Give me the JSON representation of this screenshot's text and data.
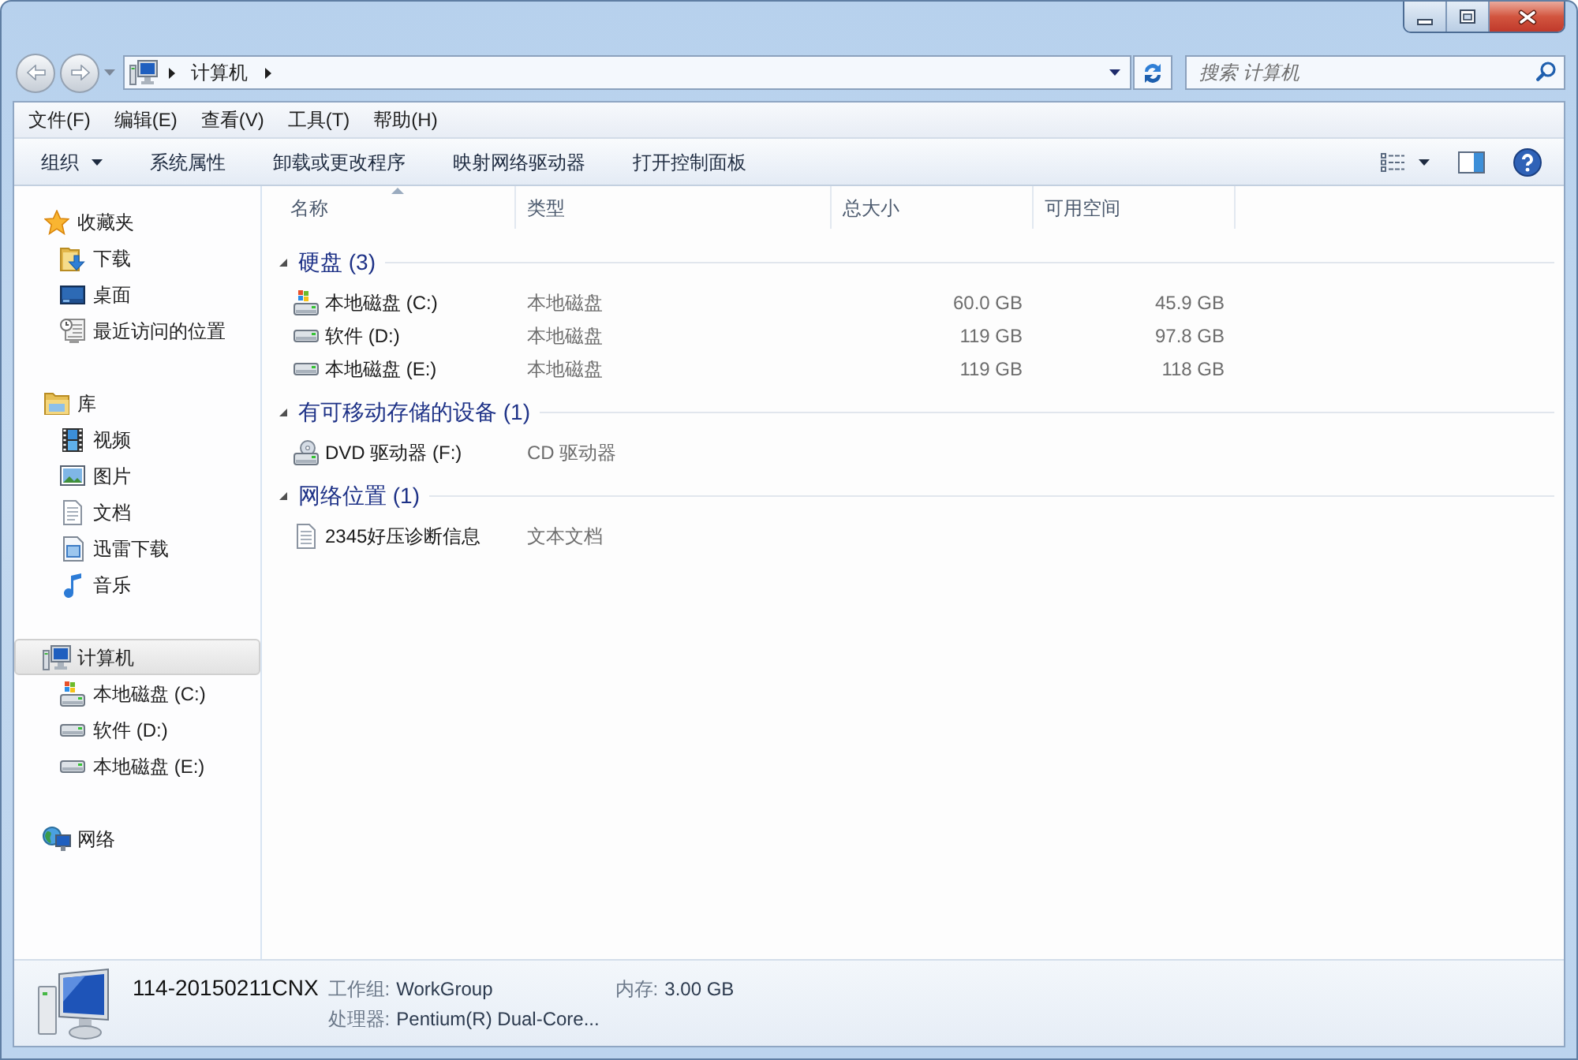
{
  "navigation": {
    "back": {
      "disabled": true
    },
    "forward": {
      "disabled": true
    }
  },
  "address_bar": {
    "path": [
      {
        "label": "计算机"
      }
    ]
  },
  "search": {
    "placeholder": "搜索 计算机"
  },
  "menu_bar": [
    "文件(F)",
    "编辑(E)",
    "查看(V)",
    "工具(T)",
    "帮助(H)"
  ],
  "command_bar": {
    "items": [
      {
        "label": "组织",
        "kind": "dropdown"
      },
      {
        "label": "系统属性",
        "kind": "button"
      },
      {
        "label": "卸载或更改程序",
        "kind": "button"
      },
      {
        "label": "映射网络驱动器",
        "kind": "button"
      },
      {
        "label": "打开控制面板",
        "kind": "button"
      }
    ]
  },
  "sidebar": {
    "sections": [
      {
        "label": "收藏夹",
        "kind": "favorites",
        "selected": false,
        "children": [
          {
            "label": "下载",
            "kind": "downloads",
            "selected": false
          },
          {
            "label": "桌面",
            "kind": "desktop",
            "selected": false
          },
          {
            "label": "最近访问的位置",
            "kind": "recent",
            "selected": false
          }
        ]
      },
      {
        "label": "库",
        "kind": "libraries",
        "selected": false,
        "children": [
          {
            "label": "视频",
            "kind": "videos",
            "selected": false
          },
          {
            "label": "图片",
            "kind": "pictures",
            "selected": false
          },
          {
            "label": "文档",
            "kind": "documents",
            "selected": false
          },
          {
            "label": "迅雷下载",
            "kind": "folder",
            "selected": false
          },
          {
            "label": "音乐",
            "kind": "music",
            "selected": false
          }
        ]
      },
      {
        "label": "计算机",
        "kind": "computer",
        "selected": true,
        "children": [
          {
            "label": "本地磁盘 (C:)",
            "kind": "system",
            "selected": false
          },
          {
            "label": "软件 (D:)",
            "kind": "drive",
            "selected": false
          },
          {
            "label": "本地磁盘 (E:)",
            "kind": "drive",
            "selected": false
          }
        ]
      },
      {
        "label": "网络",
        "kind": "network",
        "selected": false
      }
    ]
  },
  "content": {
    "columns": [
      {
        "label": "名称",
        "sorted": true
      },
      {
        "label": "类型",
        "sorted": false
      },
      {
        "label": "总大小",
        "sorted": false
      },
      {
        "label": "可用空间",
        "sorted": false
      }
    ],
    "groups": [
      {
        "label": "硬盘 (3)",
        "expanded": true,
        "items": [
          {
            "name": "本地磁盘 (C:)",
            "kind": "system",
            "type": "本地磁盘",
            "total": "60.0 GB",
            "free": "45.9 GB",
            "selected": false
          },
          {
            "name": "软件 (D:)",
            "kind": "drive",
            "type": "本地磁盘",
            "total": "119 GB",
            "free": "97.8 GB",
            "selected": false
          },
          {
            "name": "本地磁盘 (E:)",
            "kind": "drive",
            "type": "本地磁盘",
            "total": "119 GB",
            "free": "118 GB",
            "selected": false
          }
        ]
      },
      {
        "label": "有可移动存储的设备 (1)",
        "expanded": true,
        "items": [
          {
            "name": "DVD 驱动器 (F:)",
            "kind": "optical",
            "type": "CD 驱动器",
            "selected": false
          }
        ]
      },
      {
        "label": "网络位置 (1)",
        "expanded": true,
        "items": [
          {
            "name": "2345好压诊断信息",
            "kind": "document",
            "type": "文本文档",
            "selected": false
          }
        ]
      }
    ]
  },
  "details_pane": {
    "name": "114-20150211CNX",
    "rows": [
      [
        {
          "label": "工作组:",
          "value": "WorkGroup"
        },
        {
          "label": "内存:",
          "value": "3.00 GB"
        }
      ],
      [
        {
          "label": "处理器:",
          "value": "Pentium(R) Dual-Core..."
        }
      ]
    ]
  }
}
